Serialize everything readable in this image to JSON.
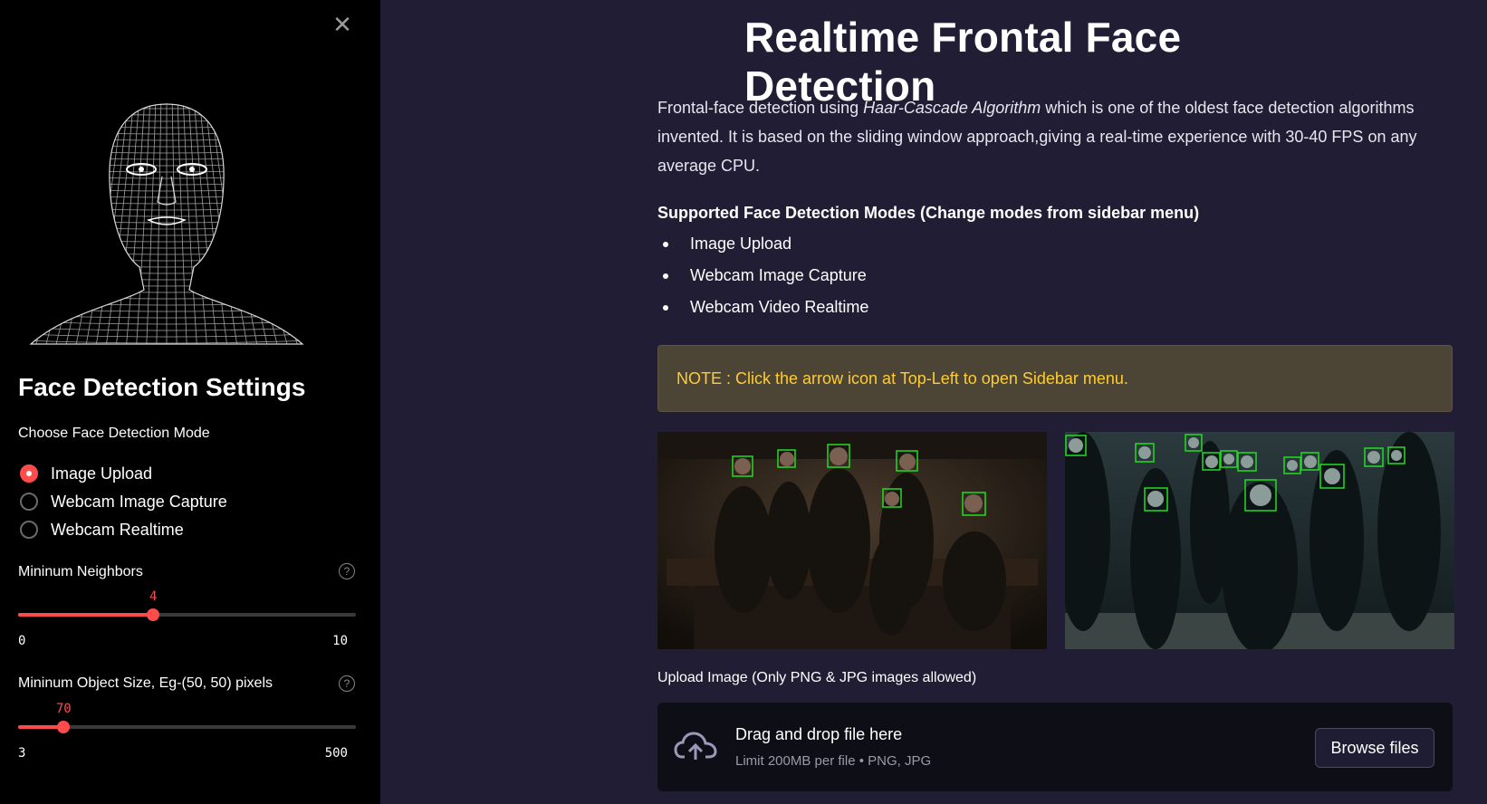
{
  "app": {
    "title": "Realtime Frontal Face Detection"
  },
  "sidebar": {
    "close_icon": "close-icon",
    "title": "Face Detection Settings",
    "mode_label": "Choose Face Detection Mode",
    "modes": [
      {
        "label": "Image Upload",
        "selected": true
      },
      {
        "label": "Webcam Image Capture",
        "selected": false
      },
      {
        "label": "Webcam Realtime",
        "selected": false
      }
    ],
    "sliders": [
      {
        "label": "Mininum Neighbors",
        "value": 4,
        "min": 0,
        "max": 10,
        "value_text": "4",
        "min_text": "0",
        "max_text": "10"
      },
      {
        "label": "Mininum Object Size, Eg-(50, 50) pixels",
        "value": 70,
        "min": 3,
        "max": 500,
        "value_text": "70",
        "min_text": "3",
        "max_text": "500"
      }
    ],
    "help_icon": "?"
  },
  "main": {
    "desc_prefix": "Frontal-face detection using ",
    "desc_em": "Haar-Cascade Algorithm",
    "desc_suffix": " which is one of the oldest face detection algorithms invented. It is based on the sliding window approach,giving a real-time experience with 30-40 FPS on any average CPU.",
    "modes_heading": "Supported Face Detection Modes (Change modes from sidebar menu)",
    "modes_list": [
      "Image Upload",
      "Webcam Image Capture",
      "Webcam Video Realtime"
    ],
    "note": "NOTE : Click the arrow icon at Top-Left to open Sidebar menu.",
    "upload": {
      "label": "Upload Image (Only PNG & JPG images allowed)",
      "drag_text": "Drag and drop file here",
      "limit_text": "Limit 200MB per file • PNG, JPG",
      "browse_label": "Browse files"
    }
  },
  "colors": {
    "accent": "#ff4b4b",
    "note_text": "#ffcc33",
    "detection_box": "#22dd22"
  }
}
